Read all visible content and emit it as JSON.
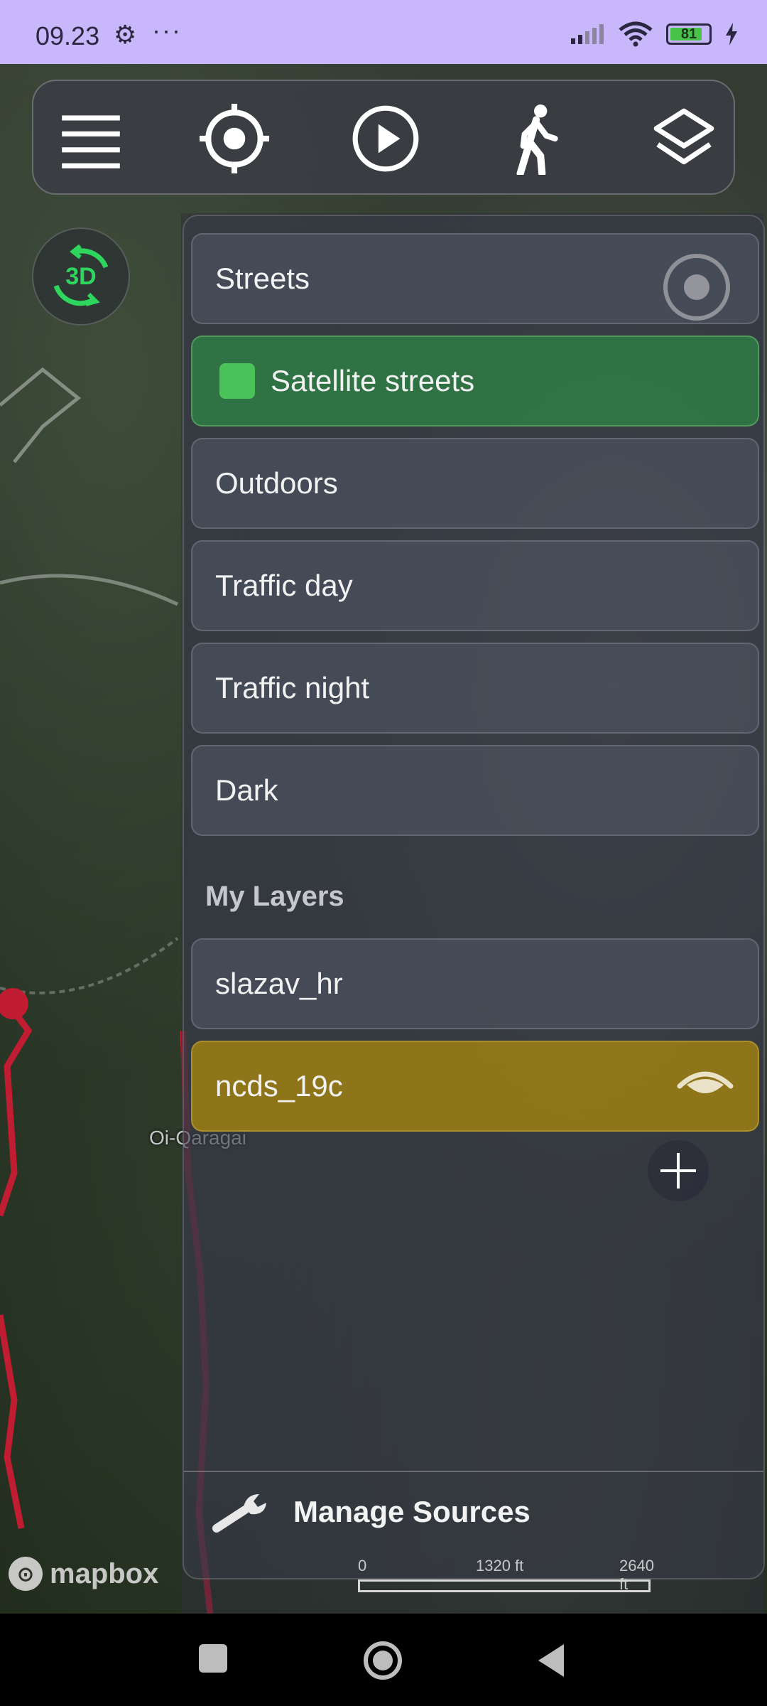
{
  "status_bar": {
    "time": "09.23",
    "settings_icon": "gear-icon",
    "more": "···",
    "battery_level": "81",
    "icons": [
      "signal-icon",
      "wifi-icon",
      "battery-icon",
      "charging-icon"
    ]
  },
  "toolbar": {
    "items": [
      {
        "name": "menu",
        "icon": "hamburger-menu-icon"
      },
      {
        "name": "locate",
        "icon": "crosshair-icon"
      },
      {
        "name": "play",
        "icon": "play-icon"
      },
      {
        "name": "walk",
        "icon": "walking-person-icon"
      },
      {
        "name": "layers",
        "icon": "layers-icon"
      }
    ]
  },
  "view_mode": {
    "label": "3D",
    "icon": "rotate-3d-icon"
  },
  "layers_panel": {
    "base_styles": [
      {
        "label": "Streets",
        "selected": false
      },
      {
        "label": "Satellite streets",
        "selected": true
      },
      {
        "label": "Outdoors",
        "selected": false
      },
      {
        "label": "Traffic day",
        "selected": false
      },
      {
        "label": "Traffic night",
        "selected": false
      },
      {
        "label": "Dark",
        "selected": false
      }
    ],
    "my_layers_title": "My Layers",
    "my_layers": [
      {
        "label": "slazav_hr",
        "visible": false
      },
      {
        "label": "ncds_19c",
        "visible": true
      }
    ],
    "manage_sources_label": "Manage Sources",
    "colors": {
      "selected_green": "#3ca853",
      "overlay_gold": "#a8861a",
      "accent_3d": "#2fd65e"
    }
  },
  "map": {
    "place_label": "Oi-Qaragai",
    "attribution": "mapbox",
    "scale": {
      "ticks": [
        "0",
        "1320 ft",
        "2640 ft"
      ]
    }
  },
  "nav_bar": {
    "items": [
      {
        "name": "recents",
        "icon": "square-icon"
      },
      {
        "name": "home",
        "icon": "circle-home-icon"
      },
      {
        "name": "back",
        "icon": "back-triangle-icon"
      }
    ]
  }
}
